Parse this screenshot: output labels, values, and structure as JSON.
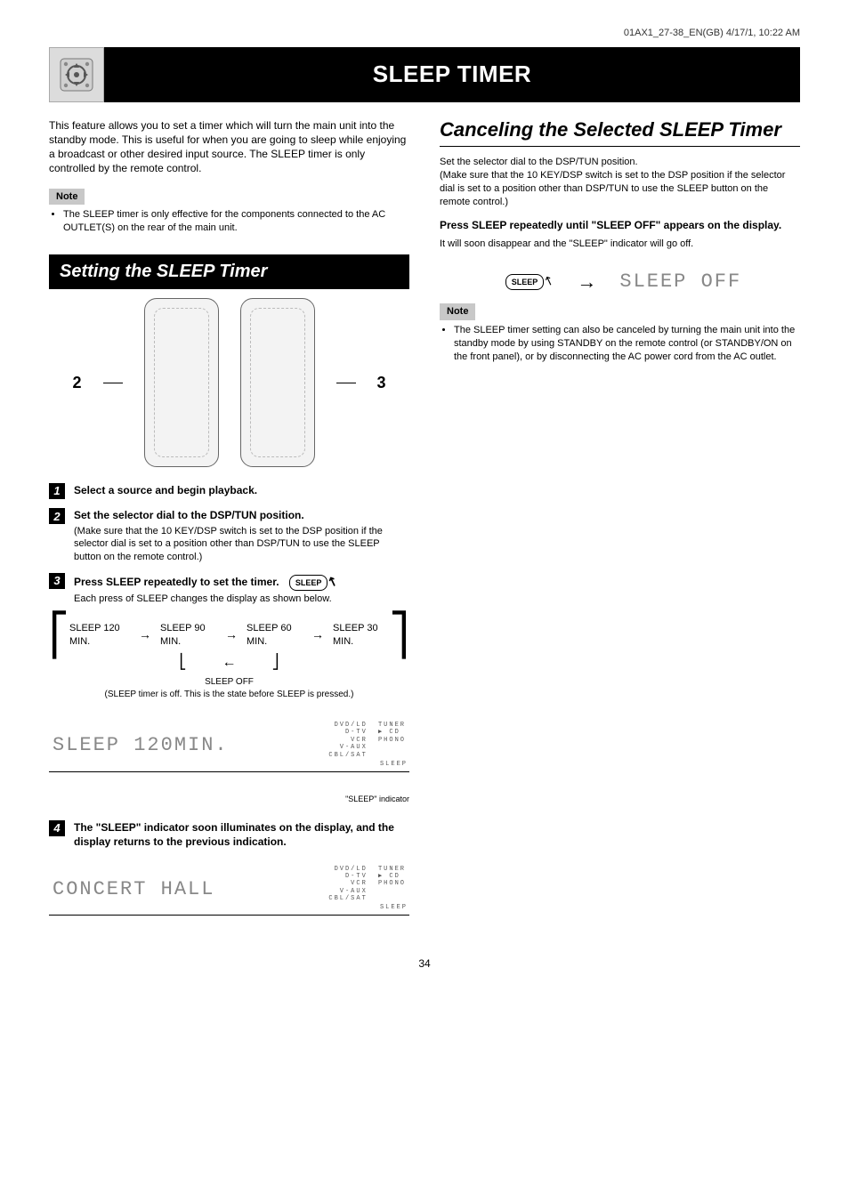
{
  "pageNumberTop": "01AX1_27-38_EN(GB)  4/17/1, 10:22 AM",
  "header": {
    "title": "SLEEP TIMER"
  },
  "intro": "This feature allows you to set a timer which will turn the main unit into the standby mode. This is useful for when you are going to sleep while enjoying a broadcast or other desired input source. The SLEEP timer is only controlled by the remote control.",
  "note1Label": "Note",
  "note1Body": "The SLEEP timer is only effective for the components connected to the AC OUTLET(S) on the rear of the main unit.",
  "sectionSetting": "Setting the SLEEP Timer",
  "callouts": {
    "left": "2",
    "right": "3"
  },
  "steps": {
    "s1": {
      "title": "Select a source and begin playback."
    },
    "s2": {
      "title": "Set the selector dial to the DSP/TUN position.",
      "desc": "(Make sure that the 10 KEY/DSP switch is set to the DSP position if the selector dial is set to a position other than DSP/TUN to use the SLEEP button on the remote control.)"
    },
    "s3": {
      "title": "Press SLEEP repeatedly to set the timer.",
      "desc": "Each press of SLEEP changes the display as shown below."
    },
    "s4": {
      "title": "The \"SLEEP\" indicator soon illuminates on the display, and the display returns to the previous indication.",
      "desc": ""
    }
  },
  "sleepBtn": "SLEEP",
  "cycle": {
    "items": [
      "SLEEP 120 MIN.",
      "SLEEP 90 MIN.",
      "SLEEP 60 MIN.",
      "SLEEP 30 MIN."
    ],
    "off": "SLEEP OFF",
    "offDesc": "(SLEEP timer is off. This is the state before SLEEP is pressed.)"
  },
  "display1": {
    "text": "SLEEP 120MIN.",
    "sourcesCol1": [
      "DVD/LD",
      "D-TV",
      "VCR",
      "V-AUX",
      "CBL/SAT"
    ],
    "sourcesCol2": [
      "TUNER",
      "▶ CD",
      "PHONO"
    ],
    "sleepTag": "SLEEP",
    "calloutLabel": "\"SLEEP\" indicator"
  },
  "display2": {
    "text": "CONCERT HALL",
    "sourcesCol1": [
      "DVD/LD",
      "D-TV",
      "VCR",
      "V-AUX",
      "CBL/SAT"
    ],
    "sourcesCol2": [
      "TUNER",
      "▶ CD",
      "PHONO"
    ],
    "sleepTag": "SLEEP"
  },
  "rightTitle": "Canceling the Selected SLEEP Timer",
  "rightSteps": {
    "intro": "Set the selector dial to the DSP/TUN position.\n(Make sure that the 10 KEY/DSP switch is set to the DSP position if the selector dial is set to a position other than DSP/TUN to use the SLEEP button on the remote control.)",
    "main": "Press SLEEP repeatedly until \"SLEEP OFF\" appears on the display.",
    "after": "It will soon disappear and the \"SLEEP\" indicator will go off."
  },
  "rightDisplay": "SLEEP OFF",
  "note2Label": "Note",
  "note2Bullets": [
    "The SLEEP timer setting can also be canceled by turning the main unit into the standby mode by using STANDBY on the remote control (or STANDBY/ON on the front panel), or by disconnecting the AC power cord from the AC outlet."
  ],
  "footerPage": "34"
}
